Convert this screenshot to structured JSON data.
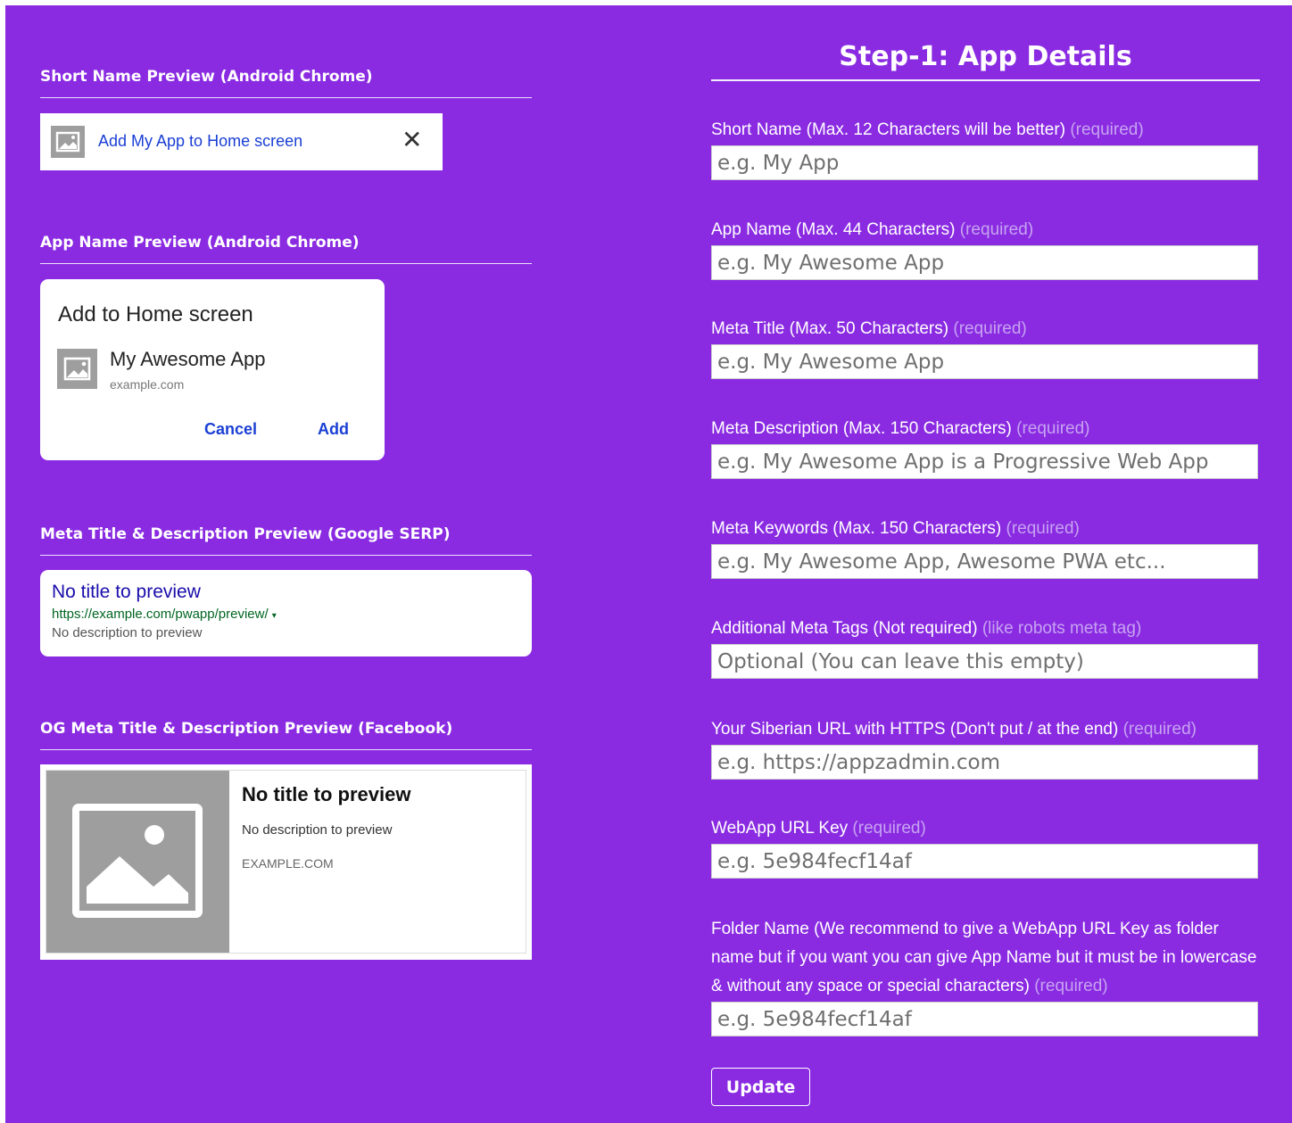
{
  "previews": {
    "short_name": {
      "title": "Short Name Preview (Android Chrome)",
      "banner_text": "Add My App to Home screen",
      "close_glyph": "✕"
    },
    "app_name": {
      "title": "App Name Preview (Android Chrome)",
      "dialog_heading": "Add to Home screen",
      "app_name": "My Awesome App",
      "domain": "example.com",
      "cancel_label": "Cancel",
      "add_label": "Add"
    },
    "serp": {
      "title": "Meta Title & Description Preview (Google SERP)",
      "result_title": "No title to preview",
      "result_url": "https://example.com/pwapp/preview/",
      "caret": "▾",
      "result_description": "No description to preview"
    },
    "facebook": {
      "title": "OG Meta Title & Description Preview (Facebook)",
      "og_title": "No title to preview",
      "og_description": "No description to preview",
      "og_domain": "EXAMPLE.COM"
    }
  },
  "form": {
    "heading": "Step-1: App Details",
    "fields": [
      {
        "label": "Short Name (Max. 12 Characters will be better)",
        "note": "(required)",
        "placeholder": "e.g. My App",
        "value": ""
      },
      {
        "label": "App Name (Max. 44 Characters)",
        "note": "(required)",
        "placeholder": "e.g. My Awesome App",
        "value": ""
      },
      {
        "label": "Meta Title (Max. 50 Characters)",
        "note": "(required)",
        "placeholder": "e.g. My Awesome App",
        "value": ""
      },
      {
        "label": "Meta Description (Max. 150 Characters)",
        "note": "(required)",
        "placeholder": "e.g. My Awesome App is a Progressive Web App",
        "value": ""
      },
      {
        "label": "Meta Keywords (Max. 150 Characters)",
        "note": "(required)",
        "placeholder": "e.g. My Awesome App, Awesome PWA etc...",
        "value": ""
      },
      {
        "label": "Additional Meta Tags (Not required)",
        "note": "(like robots meta tag)",
        "placeholder": "Optional (You can leave this empty)",
        "value": ""
      },
      {
        "label": "Your Siberian URL with HTTPS (Don't put / at the end)",
        "note": "(required)",
        "placeholder": "e.g. https://appzadmin.com",
        "value": ""
      },
      {
        "label": "WebApp URL Key",
        "note": "(required)",
        "placeholder": "e.g. 5e984fecf14af",
        "value": ""
      },
      {
        "label": "Folder Name (We recommend to give a WebApp URL Key as folder name but if you want you can give App Name but it must be in lowercase & without any space or special characters)",
        "note": "(required)",
        "placeholder": "e.g. 5e984fecf14af",
        "value": ""
      }
    ],
    "submit_label": "Update"
  },
  "colors": {
    "background": "#8a2be2",
    "link_blue": "#1a3fd4",
    "required_note": "#c7a3f0"
  }
}
